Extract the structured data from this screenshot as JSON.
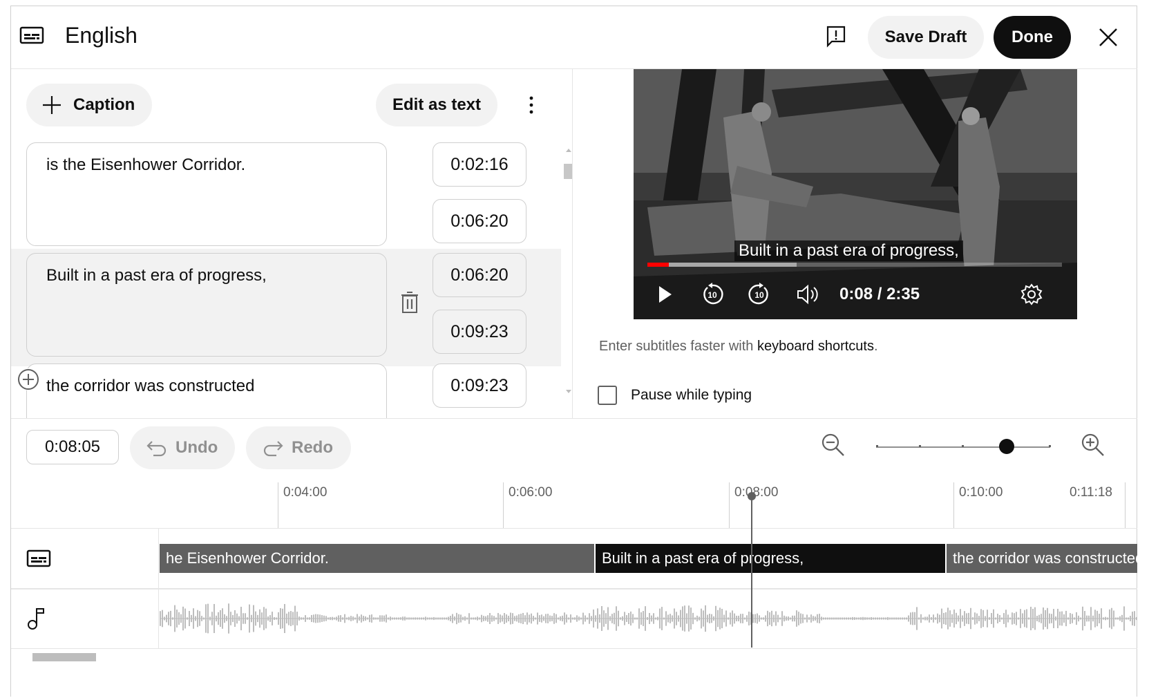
{
  "header": {
    "title": "English",
    "save_draft_label": "Save Draft",
    "done_label": "Done"
  },
  "editor": {
    "caption_button_label": "Caption",
    "edit_as_text_label": "Edit as text",
    "cues": [
      {
        "text": "is the Eisenhower Corridor.",
        "start": "0:02:16",
        "end": "0:06:20"
      },
      {
        "text": "Built in a past era of progress,",
        "start": "0:06:20",
        "end": "0:09:23"
      },
      {
        "text": "the corridor was constructed",
        "start": "0:09:23",
        "end": ""
      }
    ]
  },
  "player": {
    "subtitle": "Built in a past era of progress,",
    "time_display": "0:08 / 2:35",
    "progress_fraction": 0.052,
    "buffer_fraction": 0.36
  },
  "help": {
    "hint_prefix": "Enter subtitles faster with ",
    "hint_link": "keyboard shortcuts",
    "hint_suffix": ".",
    "pause_while_typing_label": "Pause while typing",
    "pause_while_typing_checked": false
  },
  "toolbar": {
    "current_time": "0:08:05",
    "undo_label": "Undo",
    "redo_label": "Redo",
    "zoom_level_fraction": 0.75
  },
  "timeline": {
    "ticks": [
      "0:04:00",
      "0:06:00",
      "0:08:00",
      "0:10:00",
      "0:11:18"
    ],
    "segments": [
      "he Eisenhower Corridor.",
      "Built in a past era of progress,",
      "the corridor was constructed"
    ]
  },
  "colors": {
    "accent_red": "#ff0000",
    "done_bg": "#0f0f0f",
    "pill_bg": "#f2f2f2"
  }
}
